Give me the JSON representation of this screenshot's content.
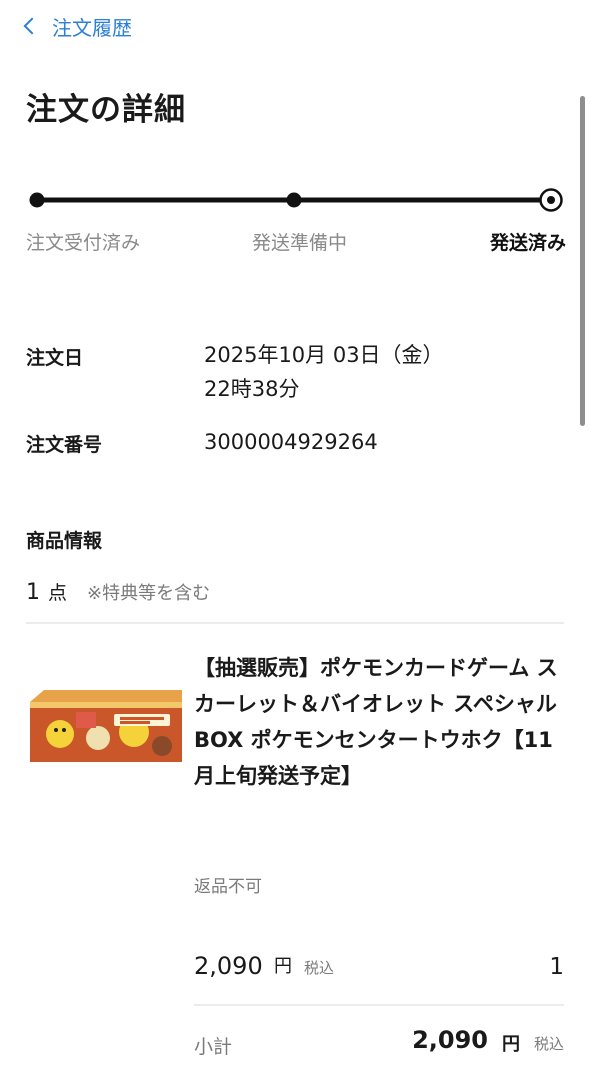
{
  "nav": {
    "back_label": "注文履歴"
  },
  "page": {
    "title": "注文の詳細"
  },
  "progress": {
    "steps": [
      {
        "label": "注文受付済み",
        "state": "done"
      },
      {
        "label": "発送準備中",
        "state": "done"
      },
      {
        "label": "発送済み",
        "state": "current"
      }
    ]
  },
  "order": {
    "date_label": "注文日",
    "date_value": "2025年10月 03日（金）",
    "time_value": "22時38分",
    "number_label": "注文番号",
    "number_value": "3000004929264"
  },
  "items_section": {
    "title": "商品情報",
    "count": "1",
    "count_unit": "点",
    "count_note": "※特典等を含む"
  },
  "product": {
    "image_icon": "product-box-image",
    "title": "【抽選販売】ポケモンカードゲーム スカーレット＆バイオレット スペシャルBOX ポケモンセンタートウホク【11月上旬発送予定】",
    "returns_note": "返品不可",
    "price": "2,090",
    "price_unit": "円",
    "tax_label": "税込",
    "quantity": "1"
  },
  "subtotal": {
    "label": "小計",
    "amount": "2,090",
    "unit": "円",
    "tax_label": "税込"
  },
  "colors": {
    "link": "#2b7fd4",
    "text": "#1a1a1a",
    "muted": "#8a8a8a"
  }
}
